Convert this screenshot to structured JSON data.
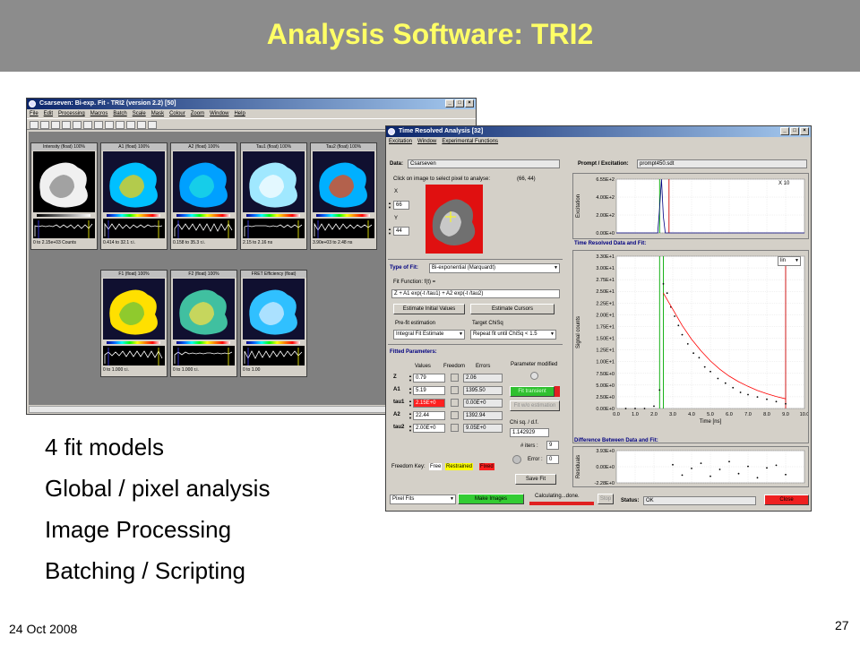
{
  "slide": {
    "title": "Analysis Software: TRI2",
    "bullets": [
      "4 fit models",
      "Global / pixel analysis",
      "Image Processing",
      "Batching / Scripting"
    ],
    "date": "24 Oct 2008",
    "page_number": "27"
  },
  "main_window": {
    "title": "Csarseven: Bi-exp. Fit - TRI2 (version 2.2)    [50]",
    "menu": [
      "File",
      "Edit",
      "Processing",
      "Macros",
      "Batch",
      "Scale",
      "Mask",
      "Colour",
      "Zoom",
      "Window",
      "Help"
    ],
    "images": [
      {
        "title": "Intensity (float) 100%",
        "range": "0 to 2.15e+03 Counts",
        "icon": "intensity-image"
      },
      {
        "title": "A1 (float) 100%",
        "range": "0.414 to 32.1 r.i.",
        "icon": "a1-image"
      },
      {
        "title": "A2 (float) 100%",
        "range": "0.158 to 35.3 r.i.",
        "icon": "a2-image"
      },
      {
        "title": "Tau1 (float) 100%",
        "range": "2.15 to 2.16 ns",
        "icon": "tau1-image"
      },
      {
        "title": "Tau2 (float) 100%",
        "range": "3.90e+03 to 2.48 ns",
        "icon": "tau2-image"
      },
      {
        "title": "F1 (float) 100%",
        "range": "0 to 1.000 r.i.",
        "icon": "f1-image"
      },
      {
        "title": "F2 (float) 100%",
        "range": "0 to 1.000 r.i.",
        "icon": "f2-image"
      },
      {
        "title": "FRET Efficiency (float)",
        "range": "0 to 1.00",
        "icon": "fret-image"
      }
    ]
  },
  "tra_window": {
    "title": "Time Resolved Analysis    [32]",
    "menu": [
      "Excitation",
      "Window",
      "Experimental Functions"
    ],
    "data_label": "Data:",
    "data_value": "Csarseven",
    "click_hint": "Click on image to select pixel to analyse:",
    "pixel_coords": "(66, 44)",
    "x_label": "X",
    "x_value": "66",
    "y_label": "Y",
    "y_value": "44",
    "type_of_fit_label": "Type of Fit:",
    "type_of_fit_value": "Bi-exponential (Marquardt)",
    "fit_function_label": "Fit Function: f(t) =",
    "fit_function_value": "Z + A1 exp(-t /tau1) + A2 exp(-t /tau2)",
    "estimate_initial_label": "Estimate Initial Values",
    "estimate_cursors_label": "Estimate Cursors",
    "prefit_label": "Pre-fit estimation",
    "prefit_value": "Integral Fit Estimate",
    "target_chisq_label": "Target ChiSq",
    "target_chisq_value": "Repeat fit until  ChiSq < 1.5",
    "fitted_params_label": "Fitted Parameters:",
    "col_values": "Values",
    "col_freedom": "Freedom",
    "col_errors": "Errors",
    "parameters": [
      {
        "name": "Z",
        "value": "0.79",
        "error": "2.06",
        "highlight": false
      },
      {
        "name": "A1",
        "value": "5.19",
        "error": "1395.50",
        "highlight": false
      },
      {
        "name": "tau1",
        "value": "2.15E+0",
        "error": "0.00E+0",
        "highlight": true
      },
      {
        "name": "A2",
        "value": "22.44",
        "error": "1392.94",
        "highlight": false
      },
      {
        "name": "tau2",
        "value": "2.00E+0",
        "error": "9.05E+0",
        "highlight": false
      }
    ],
    "param_modified_label": "Parameter modified",
    "fit_transient_label": "Fit transient",
    "fit_wo_estimation_label": "Fit w/o estimation",
    "chisq_label": "Chi sq. / d.f.",
    "chisq_value": "1.142929",
    "iters_label": "# iters :",
    "iters_value": "9",
    "error_label": "Error :",
    "error_value": "0",
    "save_fit_label": "Save Fit",
    "freedom_key_label": "Freedom Key:",
    "freedom_free": "Free",
    "freedom_restrained": "Restrained",
    "freedom_fixed": "Fixed",
    "pixel_fits_value": "Pixel Fits",
    "make_images_label": "Make Images",
    "calculating_label": "Calculating...done.",
    "stop_label": "Stop",
    "status_label": "Status:",
    "status_value": "OK",
    "close_label": "Close",
    "prompt_label": "Prompt / Excitation:",
    "prompt_value": "prompt450.sdt",
    "x10_label": "X 10",
    "lin_label": "lin",
    "trd_title": "Time Resolved Data and Fit:",
    "diff_title": "Difference Between Data and Fit:",
    "colors": {
      "data": "#000000",
      "fit": "#ff0000",
      "cursor_red": "#cc0000",
      "cursor_green": "#00aa00",
      "prompt": "#000080"
    }
  },
  "chart_data": [
    {
      "type": "line",
      "title": "",
      "ylabel": "Excitation",
      "yticks": [
        "6.55E+2",
        "4.00E+2",
        "2.00E+2",
        "0.00E+0"
      ],
      "ylim": [
        0,
        655
      ],
      "xlim": [
        0,
        10
      ],
      "series": [
        {
          "x": [
            0,
            2.2,
            2.3,
            2.4,
            2.5,
            2.6,
            10
          ],
          "y": [
            0,
            0,
            300,
            655,
            200,
            0,
            0
          ]
        }
      ]
    },
    {
      "type": "scatter",
      "title": "",
      "xlabel": "Time [ns]",
      "ylabel": "Signal counts",
      "xticks": [
        "0.0",
        "1.0",
        "2.0",
        "3.0",
        "4.0",
        "5.0",
        "6.0",
        "7.0",
        "8.0",
        "9.0",
        "10.0"
      ],
      "yticks": [
        "3.30E+1",
        "3.00E+1",
        "2.75E+1",
        "2.50E+1",
        "2.25E+1",
        "2.00E+1",
        "1.75E+1",
        "1.50E+1",
        "1.25E+1",
        "1.00E+1",
        "7.50E+0",
        "5.00E+0",
        "2.50E+0",
        "0.00E+0"
      ],
      "xlim": [
        0,
        10
      ],
      "ylim": [
        0,
        33
      ],
      "series": [
        {
          "x": [
            0.5,
            1.0,
            1.5,
            2.0,
            2.3,
            2.5,
            2.7,
            2.9,
            3.1,
            3.3,
            3.5,
            3.8,
            4.1,
            4.4,
            4.7,
            5.0,
            5.4,
            5.8,
            6.2,
            6.6,
            7.0,
            7.5,
            8.0,
            8.5,
            9.0
          ],
          "y": [
            0,
            0,
            0,
            0.5,
            4,
            27,
            25,
            22,
            20,
            18,
            16,
            14,
            12,
            11,
            9,
            8,
            6.5,
            5.5,
            4.5,
            3.5,
            3,
            2.5,
            2,
            1.5,
            1
          ]
        },
        {
          "x": [
            2.5,
            3.0,
            3.5,
            4.0,
            4.5,
            5.0,
            5.5,
            6.0,
            6.5,
            7.0,
            7.5,
            8.0,
            8.5,
            9.0
          ],
          "y": [
            25,
            21.5,
            18,
            15,
            12.5,
            10.3,
            8.5,
            7,
            5.8,
            4.8,
            3.9,
            3.2,
            2.6,
            2.1
          ]
        }
      ]
    },
    {
      "type": "scatter",
      "title": "",
      "ylabel": "Residuals",
      "yticks": [
        "3.93E+0",
        "0.00E+0",
        "-2.28E+0"
      ],
      "xlim": [
        0,
        10
      ],
      "ylim": [
        -2.28,
        3.93
      ],
      "series": [
        {
          "x": [
            3.0,
            3.5,
            4.0,
            4.5,
            5.0,
            5.5,
            6.0,
            6.5,
            7.0,
            7.5,
            8.0,
            8.5,
            9.0
          ],
          "y": [
            1.2,
            -0.8,
            0.5,
            1.5,
            -1.0,
            0.3,
            1.8,
            -0.5,
            0.9,
            -1.3,
            0.6,
            1.1,
            -0.7
          ]
        }
      ]
    }
  ]
}
